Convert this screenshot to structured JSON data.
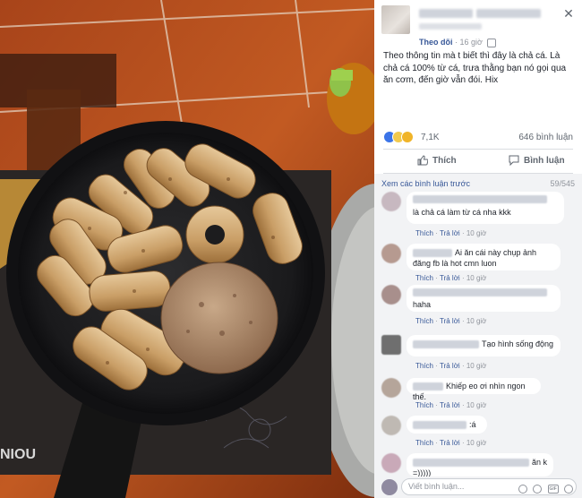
{
  "post": {
    "follow_label": "Theo dõi",
    "time": "16 giờ",
    "text": "Theo thông tin mà t biết thì đây là chả cá. Là chả cá 100% từ cá, trưa thằng bạn nó gọi qua ăn cơm, đến giờ vẫn đói. Hix",
    "reaction_count": "7,1K",
    "comment_count": "646 bình luận",
    "like_label": "Thích",
    "comment_label": "Bình luận"
  },
  "comments_section": {
    "view_previous": "Xem các bình luận trước",
    "page_count": "59/545",
    "items": [
      {
        "text": "là chả cá làm từ cá nha kkk",
        "like": "Thích",
        "reply": "Trả lời",
        "time": "10 giờ"
      },
      {
        "text": "Ai ăn cái này chụp ảnh đăng fb là hot cmn luon",
        "like": "Thích",
        "reply": "Trả lời",
        "time": "10 giờ"
      },
      {
        "text": "haha",
        "like": "Thích",
        "reply": "Trả lời",
        "time": "10 giờ"
      },
      {
        "text": "Tạo hình sống động",
        "like": "Thích",
        "reply": "Trả lời",
        "time": "10 giờ"
      },
      {
        "text": "Khiếp eo ơi nhìn ngon thế.",
        "like": "Thích",
        "reply": "Trả lời",
        "time": "10 giờ"
      },
      {
        "text": ":á",
        "like": "Thích",
        "reply": "Trả lời",
        "time": "10 giờ"
      },
      {
        "text": "ăn k =)))))"
      }
    ],
    "write_placeholder": "Viết bình luận...",
    "gif_label": "GIF"
  },
  "photo": {
    "pan_brand": "NIOU"
  },
  "colors": {
    "link": "#385898",
    "meta": "#90949c",
    "comment_bg": "#f2f3f5",
    "tile": "#b5501c"
  },
  "icons": [
    "close-icon",
    "globe-icon",
    "like-reaction-icon",
    "haha-reaction-icon",
    "sad-reaction-icon",
    "thumbs-up-icon",
    "comment-bubble-icon",
    "emoji-icon",
    "camera-icon",
    "gif-icon",
    "sticker-icon"
  ]
}
